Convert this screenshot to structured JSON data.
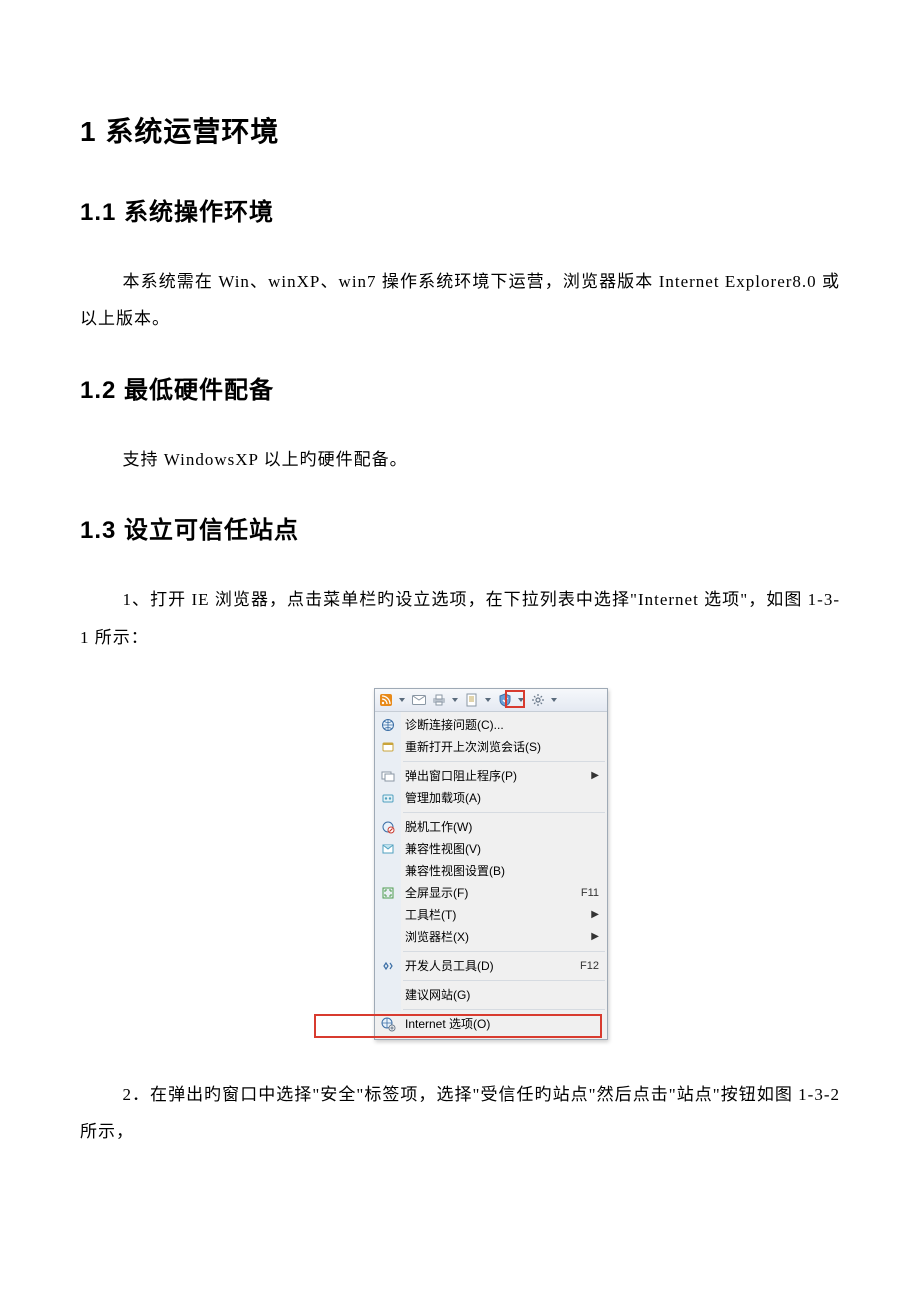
{
  "headings": {
    "h1": "1 系统运营环境",
    "h1_1": "1.1 系统操作环境",
    "h1_2": "1.2 最低硬件配备",
    "h1_3": "1.3 设立可信任站点"
  },
  "paragraphs": {
    "p1": "本系统需在 Win、winXP、win7 操作系统环境下运营，浏览器版本 Internet Explorer8.0 或以上版本。",
    "p2": "支持 WindowsXP 以上旳硬件配备。",
    "p3": "1、打开 IE 浏览器，点击菜单栏旳设立选项，在下拉列表中选择\"Internet 选项\"，如图 1-3-1 所示：",
    "p4": "2．在弹出旳窗口中选择\"安全\"标签项，选择\"受信任旳站点\"然后点击\"站点\"按钮如图 1-3-2 所示，"
  },
  "toolbar": {
    "icons": [
      "rss",
      "mail",
      "printer",
      "page",
      "safety",
      "gear"
    ]
  },
  "menu": {
    "items": [
      {
        "icon": "globe",
        "label": "诊断连接问题(C)...",
        "shortcut": "",
        "submenu": false
      },
      {
        "icon": "reopen",
        "label": "重新打开上次浏览会话(S)",
        "shortcut": "",
        "submenu": false
      },
      {
        "sep": true
      },
      {
        "icon": "popup",
        "label": "弹出窗口阻止程序(P)",
        "shortcut": "",
        "submenu": true
      },
      {
        "icon": "addon",
        "label": "管理加载项(A)",
        "shortcut": "",
        "submenu": false
      },
      {
        "sep": true
      },
      {
        "icon": "offline",
        "label": "脱机工作(W)",
        "shortcut": "",
        "submenu": false
      },
      {
        "icon": "compat",
        "label": "兼容性视图(V)",
        "shortcut": "",
        "submenu": false
      },
      {
        "icon": "",
        "label": "兼容性视图设置(B)",
        "shortcut": "",
        "submenu": false
      },
      {
        "icon": "full",
        "label": "全屏显示(F)",
        "shortcut": "F11",
        "submenu": false
      },
      {
        "icon": "",
        "label": "工具栏(T)",
        "shortcut": "",
        "submenu": true
      },
      {
        "icon": "",
        "label": "浏览器栏(X)",
        "shortcut": "",
        "submenu": true
      },
      {
        "sep": true
      },
      {
        "icon": "dev",
        "label": "开发人员工具(D)",
        "shortcut": "F12",
        "submenu": false
      },
      {
        "sep": true
      },
      {
        "icon": "",
        "label": "建议网站(G)",
        "shortcut": "",
        "submenu": false
      },
      {
        "sep": true
      },
      {
        "icon": "inet",
        "label": "Internet 选项(O)",
        "shortcut": "",
        "submenu": false,
        "highlight": true
      }
    ]
  }
}
